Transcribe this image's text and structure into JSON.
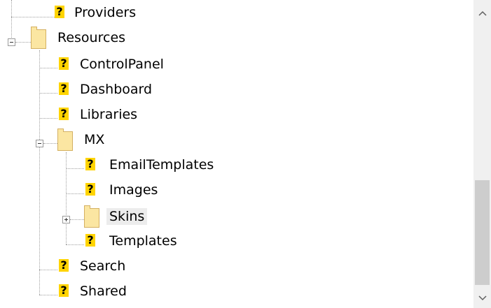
{
  "tree": {
    "nodes": [
      {
        "label": "Providers",
        "kind": "unknown",
        "level": 0
      },
      {
        "label": "Resources",
        "kind": "folder",
        "level": 0,
        "expanded": true
      },
      {
        "label": "ControlPanel",
        "kind": "unknown",
        "level": 1
      },
      {
        "label": "Dashboard",
        "kind": "unknown",
        "level": 1
      },
      {
        "label": "Libraries",
        "kind": "unknown",
        "level": 1
      },
      {
        "label": "MX",
        "kind": "folder",
        "level": 1,
        "expanded": true
      },
      {
        "label": "EmailTemplates",
        "kind": "unknown",
        "level": 2
      },
      {
        "label": "Images",
        "kind": "unknown",
        "level": 2
      },
      {
        "label": "Skins",
        "kind": "folder",
        "level": 2,
        "expanded": false,
        "selected": true
      },
      {
        "label": "Templates",
        "kind": "unknown",
        "level": 2
      },
      {
        "label": "Search",
        "kind": "unknown",
        "level": 1
      },
      {
        "label": "Shared",
        "kind": "unknown",
        "level": 1
      }
    ]
  },
  "icons": {
    "unknown": "question-mark-file-icon",
    "folder": "folder-icon",
    "collapse": "minus-box-icon",
    "expand": "plus-box-icon"
  },
  "scrollbar": {
    "up": "▲",
    "down": "▼",
    "position_fraction": 0.66
  },
  "colors": {
    "qmark_bg": "#ffd400",
    "folder_fill": "#fbe6a2",
    "selection": "#ececec"
  }
}
